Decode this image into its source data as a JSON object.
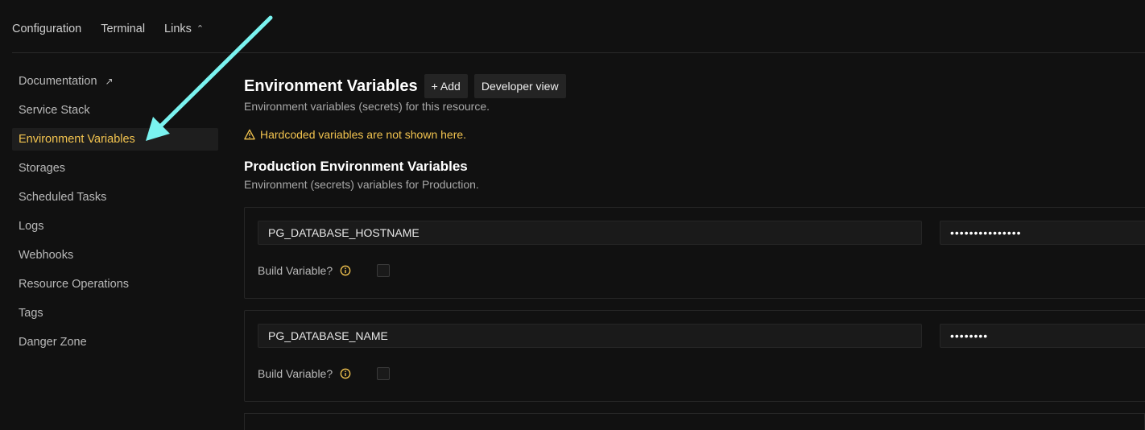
{
  "topnav": {
    "items": [
      "Configuration",
      "Terminal",
      "Links"
    ]
  },
  "sidebar": {
    "items": [
      {
        "label": "Documentation"
      },
      {
        "label": "Service Stack"
      },
      {
        "label": "Environment Variables"
      },
      {
        "label": "Storages"
      },
      {
        "label": "Scheduled Tasks"
      },
      {
        "label": "Logs"
      },
      {
        "label": "Webhooks"
      },
      {
        "label": "Resource Operations"
      },
      {
        "label": "Tags"
      },
      {
        "label": "Danger Zone"
      }
    ],
    "active_index": 2
  },
  "main": {
    "title": "Environment Variables",
    "add_button": "+ Add",
    "developer_view_button": "Developer view",
    "subtitle": "Environment variables (secrets) for this resource.",
    "warning": "Hardcoded variables are not shown here.",
    "production": {
      "title": "Production Environment Variables",
      "subtitle": "Environment (secrets) variables for Production.",
      "variables": [
        {
          "name": "PG_DATABASE_HOSTNAME",
          "value_masked": "•••••••••••••••",
          "build_label": "Build Variable?",
          "build": false
        },
        {
          "name": "PG_DATABASE_NAME",
          "value_masked": "••••••••",
          "build_label": "Build Variable?",
          "build": false
        }
      ]
    }
  },
  "colors": {
    "background": "#111111",
    "accent_yellow": "#f3c44f",
    "arrow_cyan": "#7af3f0"
  }
}
